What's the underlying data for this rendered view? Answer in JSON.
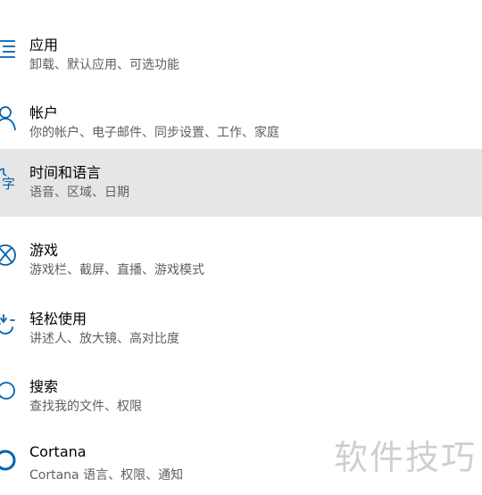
{
  "items": [
    {
      "title": "应用",
      "subtitle": "卸载、默认应用、可选功能",
      "icon": "apps-list-icon"
    },
    {
      "title": "帐户",
      "subtitle": "你的帐户、电子邮件、同步设置、工作、家庭",
      "icon": "account-person-icon"
    },
    {
      "title": "时间和语言",
      "subtitle": "语音、区域、日期",
      "icon": "time-language-icon"
    },
    {
      "title": "游戏",
      "subtitle": "游戏栏、截屏、直播、游戏模式",
      "icon": "xbox-game-icon"
    },
    {
      "title": "轻松使用",
      "subtitle": "讲述人、放大镜、高对比度",
      "icon": "ease-of-access-icon"
    },
    {
      "title": "搜索",
      "subtitle": "查找我的文件、权限",
      "icon": "search-icon"
    },
    {
      "title": "Cortana",
      "subtitle": "Cortana 语言、权限、通知",
      "icon": "cortana-icon"
    }
  ],
  "selected_index": 2,
  "watermark": "软件技巧",
  "colors": {
    "accent": "#0063b1",
    "selected_background": "#e6e6e6",
    "subtitle_text": "#5f5f5f",
    "watermark": "#cfcfcf"
  }
}
